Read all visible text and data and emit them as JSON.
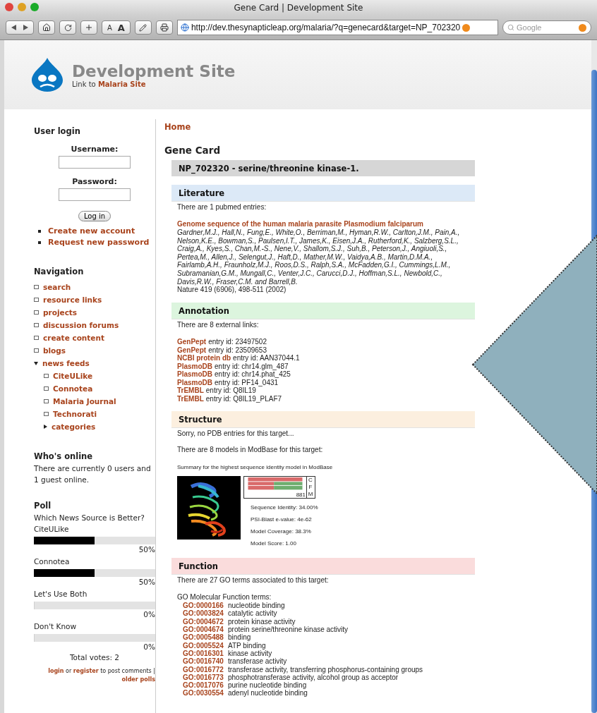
{
  "browser": {
    "title": "Gene Card | Development Site",
    "font_buttons": [
      "A",
      "A"
    ],
    "url": "http://dev.thesynapticleap.org/malaria/?q=genecard&target=NP_702320",
    "search_placeholder": "Google"
  },
  "site": {
    "name": "Development Site",
    "tagline_prefix": "Link to",
    "tagline_link": "Malaria Site"
  },
  "sidebar": {
    "login": {
      "title": "User login",
      "username_label": "Username:",
      "password_label": "Password:",
      "button": "Log in",
      "links": [
        "Create new account",
        "Request new password"
      ]
    },
    "navigation": {
      "title": "Navigation",
      "items": [
        {
          "label": "search",
          "kind": "leaf"
        },
        {
          "label": "resource links",
          "kind": "leaf"
        },
        {
          "label": "projects",
          "kind": "leaf"
        },
        {
          "label": "discussion forums",
          "kind": "leaf"
        },
        {
          "label": "create content",
          "kind": "leaf"
        },
        {
          "label": "blogs",
          "kind": "leaf"
        },
        {
          "label": "news feeds",
          "kind": "branch",
          "expanded": true,
          "children": [
            {
              "label": "CiteULike",
              "kind": "leaf"
            },
            {
              "label": "Connotea",
              "kind": "leaf"
            },
            {
              "label": "Malaria Journal",
              "kind": "leaf"
            },
            {
              "label": "Technorati",
              "kind": "leaf"
            },
            {
              "label": "categories",
              "kind": "branch",
              "expanded": false
            }
          ]
        }
      ]
    },
    "online": {
      "title": "Who's online",
      "text": "There are currently 0 users and 1 guest online."
    },
    "poll": {
      "title": "Poll",
      "question": "Which News Source is Better?",
      "choices": [
        {
          "label": "CiteULike",
          "level": 0.5,
          "percent": "50%"
        },
        {
          "label": "Connotea",
          "level": 0.5,
          "percent": "50%"
        },
        {
          "label": "Let's Use Both",
          "level": 0,
          "percent": "0%"
        },
        {
          "label": "Don't Know",
          "level": 0,
          "percent": "0%"
        }
      ],
      "total": "Total votes: 2",
      "footer": [
        {
          "text": "login",
          "link": true
        },
        {
          "text": "or",
          "link": false
        },
        {
          "text": "register",
          "link": true
        },
        {
          "text": "to post comments |",
          "link": false
        },
        {
          "text": "older polls",
          "link": true
        }
      ]
    }
  },
  "main": {
    "breadcrumb": "Home",
    "title": "Gene Card",
    "gene_header": "NP_702320 - serine/threonine kinase-1.",
    "sections": [
      {
        "kind": "literature",
        "title": "Literature",
        "color": "#dce9f7",
        "intro": "There are 1 pubmed entries:",
        "entries": [
          {
            "title": "Genome sequence of the human malaria parasite Plasmodium falciparum",
            "authors": "Gardner,M.J., Hall,N., Fung,E., White,O., Berriman,M., Hyman,R.W., Carlton,J.M., Pain,A., Nelson,K.E., Bowman,S., Paulsen,I.T., James,K., Eisen,J.A., Rutherford,K., Salzberg,S.L., Craig,A., Kyes,S., Chan,M.-S., Nene,V., Shallom,S.J., Suh,B., Peterson,J., Angiuoli,S., Pertea,M., Allen,J., Selengut,J., Haft,D., Mather,M.W., Vaidya,A.B., Martin,D.M.A., Fairlamb,A.H., Fraunholz,M.J., Roos,D.S., Ralph,S.A., McFadden,G.I., Cummings,L.M., Subramanian,G.M., Mungall,C., Venter,J.C., Carucci,D.J., Hoffman,S.L., Newbold,C., Davis,R.W., Fraser,C.M. and Barrell,B.",
            "citation": "Nature 419 (6906), 498-511 (2002)"
          }
        ]
      },
      {
        "kind": "annotation",
        "title": "Annotation",
        "color": "#dcf5de",
        "intro": "There are 8 external links:",
        "links": [
          {
            "source": "GenPept",
            "text": "entry id: 23497502"
          },
          {
            "source": "GenPept",
            "text": "entry id: 23509653"
          },
          {
            "source": "NCBI protein db",
            "text": "entry id: AAN37044.1"
          },
          {
            "source": "PlasmoDB",
            "text": "entry id: chr14.glm_487"
          },
          {
            "source": "PlasmoDB",
            "text": "entry id: chr14.phat_425"
          },
          {
            "source": "PlasmoDB",
            "text": "entry id: PF14_0431"
          },
          {
            "source": "TrEMBL",
            "text": "entry id: Q8IL19"
          },
          {
            "source": "TrEMBL",
            "text": "entry id: Q8IL19_PLAF7"
          }
        ]
      },
      {
        "kind": "structure",
        "title": "Structure",
        "color": "#fcefdf",
        "note": "Sorry, no PDB entries for this target...",
        "modbase": "There are 8 models in ModBase for this target:",
        "summary": "Summary for the highest sequence identity model in ModBase",
        "alignment_labels": [
          "C",
          "F",
          "M"
        ],
        "alignment_length": "881",
        "stats": [
          "Sequence Identity: 34.00%",
          "PSI-Blast e-value: 4e-62",
          "Model Coverage: 38.3%",
          "Model Score: 1.00"
        ]
      },
      {
        "kind": "function",
        "title": "Function",
        "color": "#fadcdc",
        "intro": "There are 27 GO terms associated to this target:",
        "group_title": "GO Molecular Function terms:",
        "terms": [
          {
            "id": "GO:0000166",
            "name": "nucleotide binding"
          },
          {
            "id": "GO:0003824",
            "name": "catalytic activity"
          },
          {
            "id": "GO:0004672",
            "name": "protein kinase activity"
          },
          {
            "id": "GO:0004674",
            "name": "protein serine/threonine kinase activity"
          },
          {
            "id": "GO:0005488",
            "name": "binding"
          },
          {
            "id": "GO:0005524",
            "name": "ATP binding"
          },
          {
            "id": "GO:0016301",
            "name": "kinase activity"
          },
          {
            "id": "GO:0016740",
            "name": "transferase activity"
          },
          {
            "id": "GO:0016772",
            "name": "transferase activity, transferring phosphorus-containing groups"
          },
          {
            "id": "GO:0016773",
            "name": "phosphotransferase activity, alcohol group as acceptor"
          },
          {
            "id": "GO:0017076",
            "name": "purine nucleotide binding"
          },
          {
            "id": "GO:0030554",
            "name": "adenyl nucleotide binding"
          }
        ]
      }
    ]
  }
}
